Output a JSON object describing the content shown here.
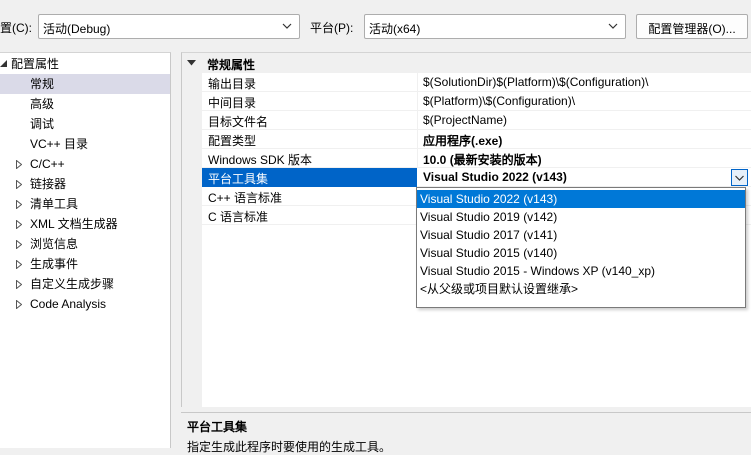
{
  "toolbar": {
    "config_label": "置(C):",
    "config_value": "活动(Debug)",
    "platform_label": "平台(P):",
    "platform_value": "活动(x64)",
    "config_manager_label": "配置管理器(O)..."
  },
  "tree": {
    "root": "配置属性",
    "items": [
      {
        "label": "常规",
        "selected": true,
        "expandable": false
      },
      {
        "label": "高级",
        "expandable": false
      },
      {
        "label": "调试",
        "expandable": false
      },
      {
        "label": "VC++ 目录",
        "expandable": false
      },
      {
        "label": "C/C++",
        "expandable": true
      },
      {
        "label": "链接器",
        "expandable": true
      },
      {
        "label": "清单工具",
        "expandable": true
      },
      {
        "label": "XML 文档生成器",
        "expandable": true
      },
      {
        "label": "浏览信息",
        "expandable": true
      },
      {
        "label": "生成事件",
        "expandable": true
      },
      {
        "label": "自定义生成步骤",
        "expandable": true
      },
      {
        "label": "Code Analysis",
        "expandable": true
      }
    ]
  },
  "grid": {
    "category": "常规属性",
    "rows": [
      {
        "name": "输出目录",
        "value": "$(SolutionDir)$(Platform)\\$(Configuration)\\",
        "bold": false
      },
      {
        "name": "中间目录",
        "value": "$(Platform)\\$(Configuration)\\",
        "bold": false
      },
      {
        "name": "目标文件名",
        "value": "$(ProjectName)",
        "bold": false
      },
      {
        "name": "配置类型",
        "value": "应用程序(.exe)",
        "bold": true
      },
      {
        "name": "Windows SDK 版本",
        "value": "10.0 (最新安装的版本)",
        "bold": true
      },
      {
        "name": "平台工具集",
        "value": "Visual Studio 2022 (v143)",
        "bold": true,
        "selected": true
      },
      {
        "name": "C++ 语言标准",
        "value": "",
        "bold": false
      },
      {
        "name": "C 语言标准",
        "value": "",
        "bold": false
      }
    ]
  },
  "dropdown": {
    "options": [
      "Visual Studio 2022 (v143)",
      "Visual Studio 2019 (v142)",
      "Visual Studio 2017 (v141)",
      "Visual Studio 2015 (v140)",
      "Visual Studio 2015 - Windows XP (v140_xp)",
      "<从父级或项目默认设置继承>"
    ],
    "highlighted_index": 0
  },
  "description": {
    "title": "平台工具集",
    "body": "指定生成此程序时要使用的生成工具。"
  },
  "colors": {
    "selection": "#0064c8",
    "dropdown_highlight": "#0078d7",
    "tree_selection": "#dadae8"
  }
}
